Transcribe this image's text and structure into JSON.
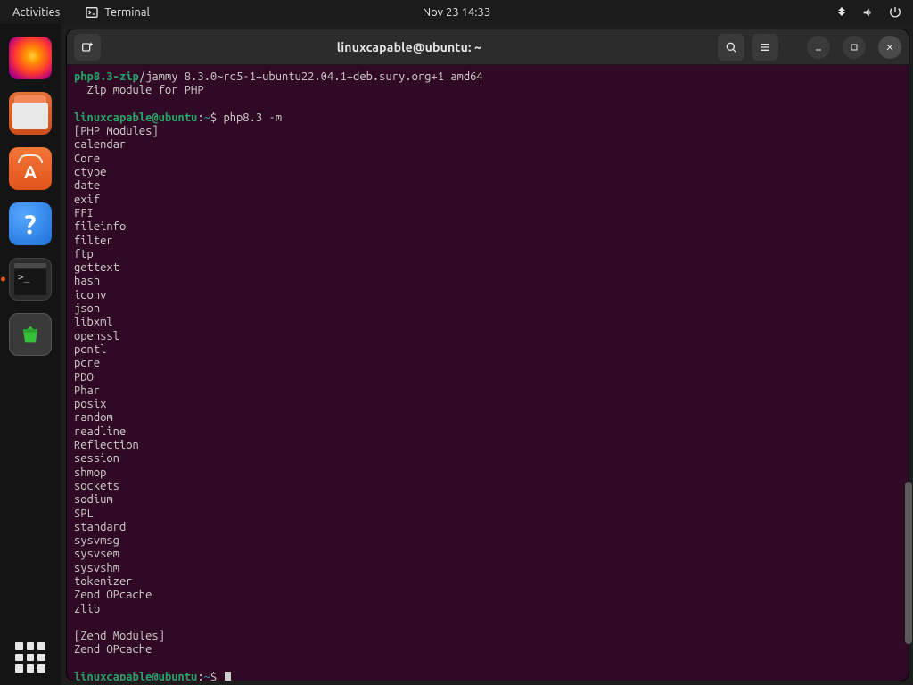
{
  "topbar": {
    "activities": "Activities",
    "app_label": "Terminal",
    "clock": "Nov 23  14:33"
  },
  "dock": {
    "tooltip": "Terminal"
  },
  "window": {
    "title": "linuxcapable@ubuntu: ~"
  },
  "terminal": {
    "pkg_name": "php8.3-zip",
    "pkg_rest": "/jammy 8.3.0~rc5-1+ubuntu22.04.1+deb.sury.org+1 amd64",
    "pkg_desc": "  Zip module for PHP",
    "prompt_user": "linuxcapable@ubuntu",
    "prompt_path": "~",
    "prompt_sep1": ":",
    "prompt_sep2": "$",
    "cmd1": "php8.3 -m",
    "section1": "[PHP Modules]",
    "modules": [
      "calendar",
      "Core",
      "ctype",
      "date",
      "exif",
      "FFI",
      "fileinfo",
      "filter",
      "ftp",
      "gettext",
      "hash",
      "iconv",
      "json",
      "libxml",
      "openssl",
      "pcntl",
      "pcre",
      "PDO",
      "Phar",
      "posix",
      "random",
      "readline",
      "Reflection",
      "session",
      "shmop",
      "sockets",
      "sodium",
      "SPL",
      "standard",
      "sysvmsg",
      "sysvsem",
      "sysvshm",
      "tokenizer",
      "Zend OPcache",
      "zlib"
    ],
    "blank": "",
    "section2": "[Zend Modules]",
    "zend": [
      "Zend OPcache"
    ]
  }
}
